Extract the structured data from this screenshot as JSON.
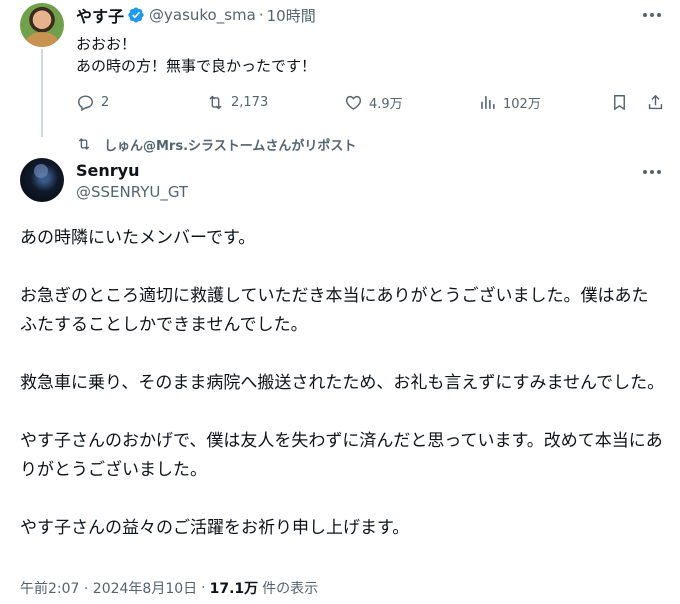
{
  "tweet1": {
    "display_name": "やす子",
    "handle": "@yasuko_sma",
    "separator": "·",
    "time": "10時間",
    "text_lines": [
      "おおお！",
      "あの時の方！無事で良かったです！"
    ],
    "reply_count": "2",
    "retweet_count": "2,173",
    "like_count": "4.9万",
    "view_count": "102万"
  },
  "repost_label": "しゅん@Mrs.シラストームさんがリポスト",
  "tweet2": {
    "display_name": "Senryu",
    "handle": "@SSENRYU_GT",
    "paragraphs": [
      "あの時隣にいたメンバーです。",
      "お急ぎのところ適切に救護していただき本当にありがとうございました。僕はあたふたすることしかできませんでした。",
      "救急車に乗り、そのまま病院へ搬送されたため、お礼も言えずにすみませんでした。",
      "やす子さんのおかげで、僕は友人を失わずに済んだと思っています。改めて本当にありがとうございました。",
      "やす子さんの益々のご活躍をお祈り申し上げます。"
    ],
    "timestamp": "午前2:07 · 2024年8月10日",
    "separator": "·",
    "views_count": "17.1万",
    "views_label": "件の表示"
  },
  "colors": {
    "verified": "#1d9bf0",
    "secondary_text": "#536471",
    "primary_text": "#0f1419"
  },
  "icons": [
    "verified-badge-icon",
    "more-icon",
    "reply-icon",
    "retweet-icon",
    "like-icon",
    "views-icon",
    "bookmark-icon",
    "share-icon",
    "repost-icon"
  ]
}
